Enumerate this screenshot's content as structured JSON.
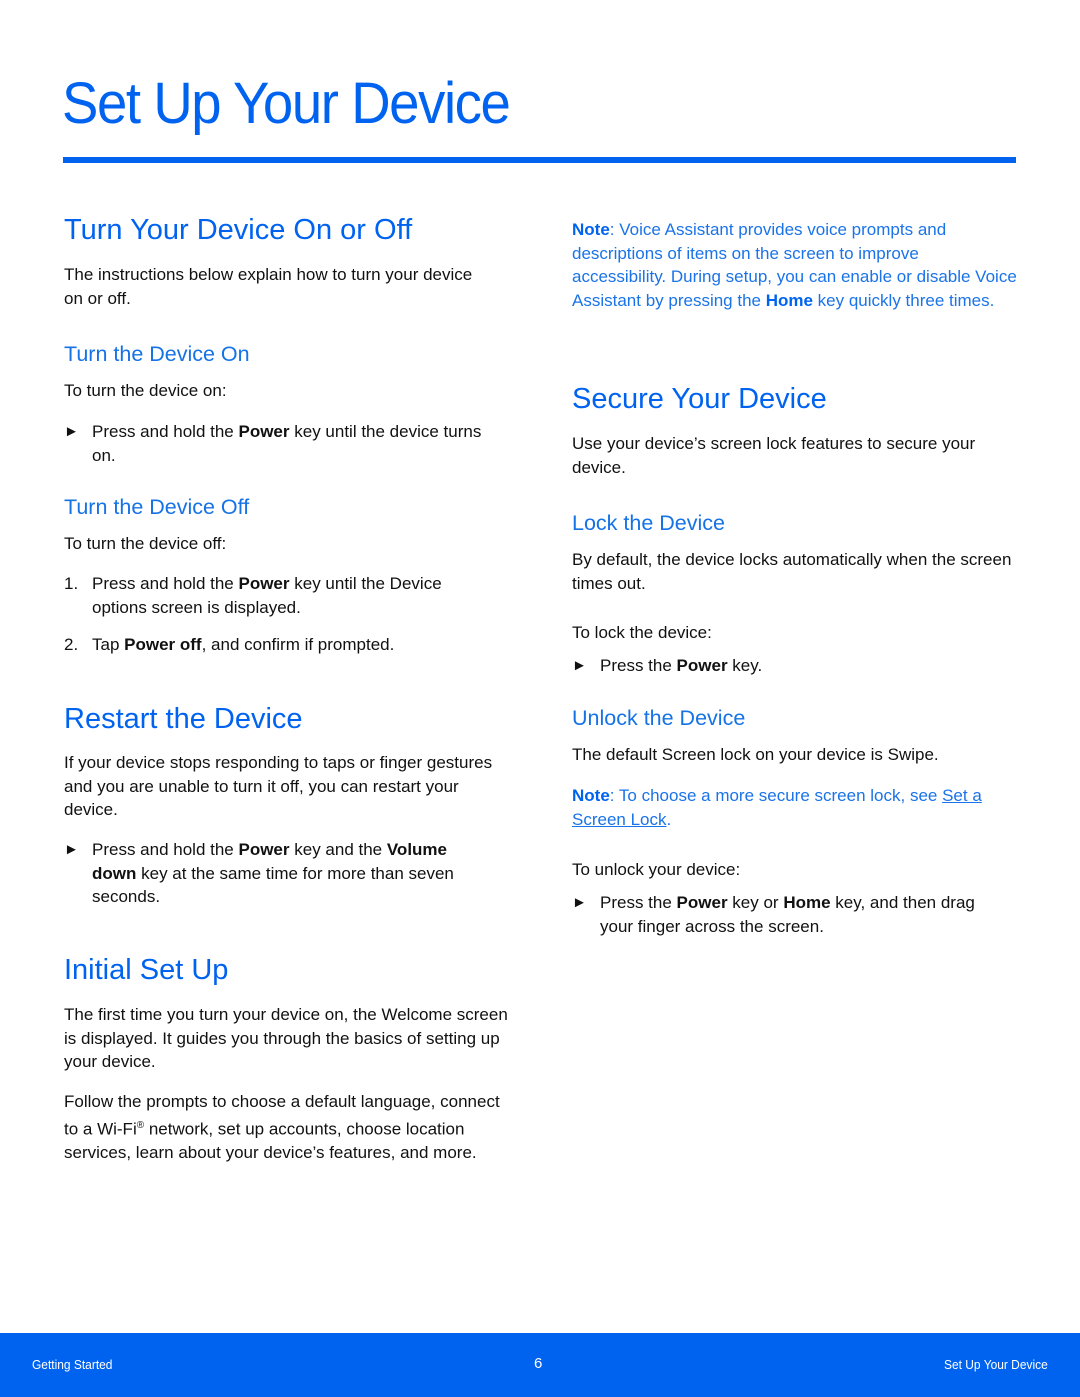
{
  "page_title": "Set Up Your Device",
  "colors": {
    "accent": "#0063F0",
    "note": "#1A73E8",
    "text": "#111111",
    "footer_bg": "#0063F0"
  },
  "left": {
    "turn_on_off": {
      "heading": "Turn Your Device On or Off",
      "intro": "The instructions below explain how to turn your device on or off.",
      "on": {
        "heading": "Turn the Device On",
        "lead": "To turn the device on:",
        "bullet": {
          "icon": "arrow-bullet",
          "pre": "Press and hold the ",
          "bold": "Power",
          "post": " key until the device turns on."
        }
      },
      "off": {
        "heading": "Turn the Device Off",
        "lead": "To turn the device off:",
        "steps": [
          {
            "num": "1.",
            "pre": "Press and hold the ",
            "bold": "Power",
            "post": " key until the Device options screen is displayed."
          },
          {
            "num": "2.",
            "pre": "Tap ",
            "bold": "Power off",
            "post": ", and confirm if prompted."
          }
        ]
      }
    },
    "restart": {
      "heading": "Restart the Device",
      "intro": "If your device stops responding to taps or finger gestures and you are unable to turn it off, you can restart your device.",
      "bullet": {
        "pre": "Press and hold the ",
        "bold1": "Power",
        "mid": " key and the ",
        "bold2": "Volume down",
        "post": " key at the same time for more than seven seconds."
      }
    },
    "initial": {
      "heading": "Initial Set Up",
      "p1": "The first time you turn your device on, the Welcome screen is displayed. It guides you through the basics of setting up your device.",
      "p2_pre": "Follow the prompts to choose a default language, connect to a Wi-Fi",
      "p2_sup": "®",
      "p2_post": " network, set up accounts, choose location services, learn about your device’s features, and more."
    }
  },
  "right": {
    "note1": {
      "label": "Note",
      "pre": ": Voice Assistant provides voice prompts and descriptions of items on the screen to improve accessibility. During setup, you can enable or disable Voice Assistant by pressing the ",
      "bold": "Home",
      "post": " key quickly three times."
    },
    "secure": {
      "heading": "Secure Your Device",
      "intro": "Use your device’s screen lock features to secure your device.",
      "lock": {
        "heading": "Lock the Device",
        "p": "By default, the device locks automatically when the screen times out.",
        "lead": "To lock the device:",
        "bullet": {
          "pre": "Press the ",
          "bold": "Power",
          "post": " key."
        }
      },
      "unlock": {
        "heading": "Unlock the Device",
        "p": "The default Screen lock on your device is Swipe.",
        "note": {
          "label": "Note",
          "pre": ": To choose a more secure screen lock, see ",
          "link": "Set a Screen Lock",
          "post": "."
        },
        "lead": "To unlock your device:",
        "bullet": {
          "pre": "Press the ",
          "bold1": "Power",
          "mid": " key or ",
          "bold2": "Home",
          "post": " key, and then drag your finger across the screen."
        }
      }
    }
  },
  "bullet_glyph": "►",
  "footer": {
    "left": "Getting Started",
    "page_number": "6",
    "right": "Set Up Your Device"
  }
}
